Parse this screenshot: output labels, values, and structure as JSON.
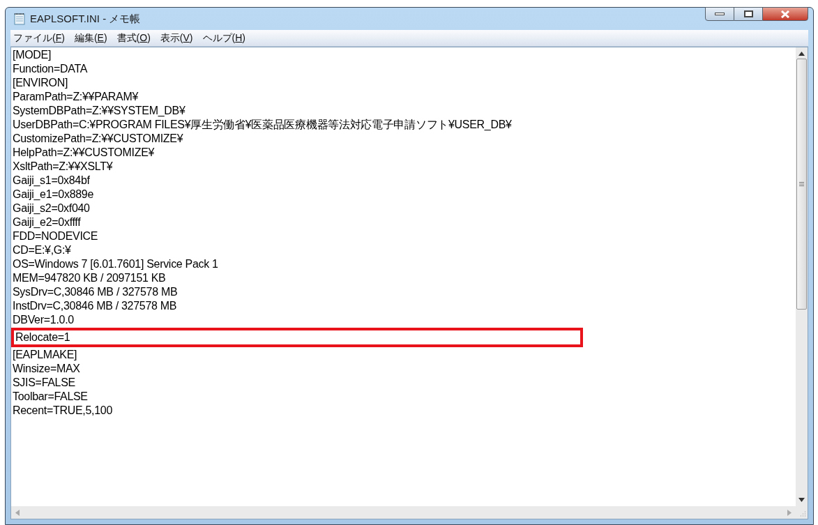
{
  "window": {
    "title": "EAPLSOFT.INI - メモ帳"
  },
  "menu": [
    {
      "label": "ファイル(F)"
    },
    {
      "label": "編集(E)"
    },
    {
      "label": "書式(O)"
    },
    {
      "label": "表示(V)"
    },
    {
      "label": "ヘルプ(H)"
    }
  ],
  "editor": {
    "lines": [
      {
        "text": "[MODE]",
        "highlighted": false
      },
      {
        "text": "Function=DATA",
        "highlighted": false
      },
      {
        "text": "[ENVIRON]",
        "highlighted": false
      },
      {
        "text": "ParamPath=Z:¥¥PARAM¥",
        "highlighted": false
      },
      {
        "text": "SystemDBPath=Z:¥¥SYSTEM_DB¥",
        "highlighted": false
      },
      {
        "text": "UserDBPath=C:¥PROGRAM FILES¥厚生労働省¥医薬品医療機器等法対応電子申請ソフト¥USER_DB¥",
        "highlighted": false
      },
      {
        "text": "CustomizePath=Z:¥¥CUSTOMIZE¥",
        "highlighted": false
      },
      {
        "text": "HelpPath=Z:¥¥CUSTOMIZE¥",
        "highlighted": false
      },
      {
        "text": "XsltPath=Z:¥¥XSLT¥",
        "highlighted": false
      },
      {
        "text": "Gaiji_s1=0x84bf",
        "highlighted": false
      },
      {
        "text": "Gaiji_e1=0x889e",
        "highlighted": false
      },
      {
        "text": "Gaiji_s2=0xf040",
        "highlighted": false
      },
      {
        "text": "Gaiji_e2=0xffff",
        "highlighted": false
      },
      {
        "text": "FDD=NODEVICE",
        "highlighted": false
      },
      {
        "text": "CD=E:¥,G:¥",
        "highlighted": false
      },
      {
        "text": "OS=Windows 7 [6.01.7601] Service Pack 1",
        "highlighted": false
      },
      {
        "text": "MEM=947820 KB / 2097151 KB",
        "highlighted": false
      },
      {
        "text": "SysDrv=C,30846 MB / 327578 MB",
        "highlighted": false
      },
      {
        "text": "InstDrv=C,30846 MB / 327578 MB",
        "highlighted": false
      },
      {
        "text": "DBVer=1.0.0",
        "highlighted": false
      },
      {
        "text": "Relocate=1",
        "highlighted": true
      },
      {
        "text": "[EAPLMAKE]",
        "highlighted": false
      },
      {
        "text": "Winsize=MAX",
        "highlighted": false
      },
      {
        "text": "SJIS=FALSE",
        "highlighted": false
      },
      {
        "text": "Toolbar=FALSE",
        "highlighted": false
      },
      {
        "text": "Recent=TRUE,5,100",
        "highlighted": false
      }
    ]
  }
}
